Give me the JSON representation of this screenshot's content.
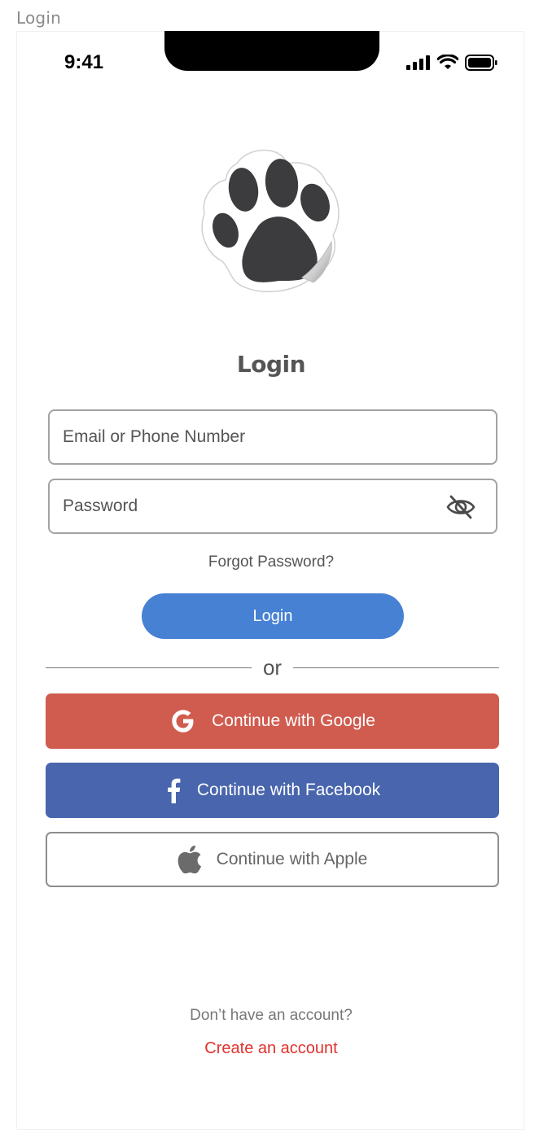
{
  "frame": {
    "label": "Login"
  },
  "status_bar": {
    "time": "9:41"
  },
  "login": {
    "title": "Login",
    "email_placeholder": "Email or Phone Number",
    "password_placeholder": "Password",
    "forgot": "Forgot Password?",
    "button": "Login",
    "divider": "or"
  },
  "social": {
    "google": "Continue with Google",
    "facebook": "Continue with Facebook",
    "apple": "Continue with Apple"
  },
  "footer": {
    "prompt": "Don’t have an account?",
    "create": "Create an account"
  },
  "colors": {
    "primary": "#4681d4",
    "google": "#d05c4f",
    "facebook": "#4865ad",
    "link": "#e0322c"
  },
  "icons": [
    "paw-logo-icon",
    "signal-icon",
    "wifi-icon",
    "battery-icon",
    "eye-slash-icon",
    "google-icon",
    "facebook-icon",
    "apple-icon"
  ]
}
